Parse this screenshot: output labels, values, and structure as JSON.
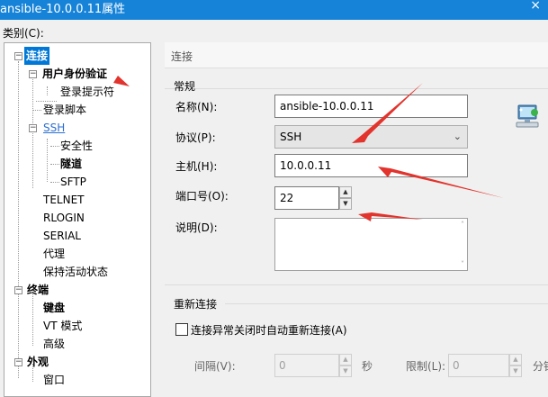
{
  "window": {
    "title": "ansible-10.0.0.11属性",
    "close": "×"
  },
  "category_label": "类别(C):",
  "tree": {
    "items": [
      {
        "label": "连接",
        "expander": "−"
      },
      {
        "label": "用户身份验证",
        "expander": "−"
      },
      {
        "label": "登录提示符"
      },
      {
        "label": "登录脚本"
      },
      {
        "label": "SSH",
        "expander": "−"
      },
      {
        "label": "安全性"
      },
      {
        "label": "隧道"
      },
      {
        "label": "SFTP"
      },
      {
        "label": "TELNET"
      },
      {
        "label": "RLOGIN"
      },
      {
        "label": "SERIAL"
      },
      {
        "label": "代理"
      },
      {
        "label": "保持活动状态"
      },
      {
        "label": "终端",
        "expander": "−"
      },
      {
        "label": "键盘"
      },
      {
        "label": "VT 模式"
      },
      {
        "label": "高级"
      },
      {
        "label": "外观",
        "expander": "−"
      },
      {
        "label": "窗口"
      }
    ]
  },
  "pane": {
    "header": "连接",
    "general": {
      "title": "常规",
      "name_label": "名称(N):",
      "name_value": "ansible-10.0.0.11",
      "protocol_label": "协议(P):",
      "protocol_value": "SSH",
      "host_label": "主机(H):",
      "host_value": "10.0.0.11",
      "port_label": "端口号(O):",
      "port_value": "22",
      "desc_label": "说明(D):",
      "desc_value": ""
    },
    "reconnect": {
      "title": "重新连接",
      "auto_label": "连接异常关闭时自动重新连接(A)",
      "interval_label": "间隔(V):",
      "interval_value": "0",
      "interval_unit": "秒",
      "limit_label": "限制(L):",
      "limit_value": "0",
      "limit_unit": "分钟"
    }
  },
  "colors": {
    "titlebar": "#1683d8",
    "selection": "#0078d7",
    "annotation_arrow": "#e2332c"
  },
  "icons": [
    "close-icon",
    "computer-network-icon",
    "dropdown-arrow-icon",
    "spin-up-icon",
    "spin-down-icon"
  ]
}
